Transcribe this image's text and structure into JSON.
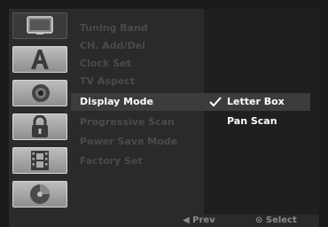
{
  "sidebar": {
    "items": [
      {
        "icon": "tv-icon",
        "active": true
      },
      {
        "icon": "language-a-icon",
        "active": false
      },
      {
        "icon": "speaker-icon",
        "active": false
      },
      {
        "icon": "lock-icon",
        "active": false
      },
      {
        "icon": "film-icon",
        "active": false
      },
      {
        "icon": "disc-icon",
        "active": false
      }
    ]
  },
  "menu": {
    "items": [
      {
        "label": "Tuning Band"
      },
      {
        "label": "CH. Add/Del"
      },
      {
        "label": "Clock Set"
      },
      {
        "label": "TV Aspect"
      },
      {
        "label": "Display Mode",
        "selected": true
      },
      {
        "label": "Progressive Scan"
      },
      {
        "label": "Power Save Mode"
      },
      {
        "label": "Factory Set"
      }
    ]
  },
  "options": {
    "items": [
      {
        "label": "Letter Box",
        "selected": true,
        "checked": true
      },
      {
        "label": "Pan Scan"
      }
    ]
  },
  "footer": {
    "prev_label": "◀ Prev",
    "select_label": "⊙ Select"
  },
  "colors": {
    "background": "#1a1a1a",
    "menu_text_dim": "#4a4a4a",
    "selected_text": "#ffffff",
    "highlight": "#3c3c3c"
  }
}
